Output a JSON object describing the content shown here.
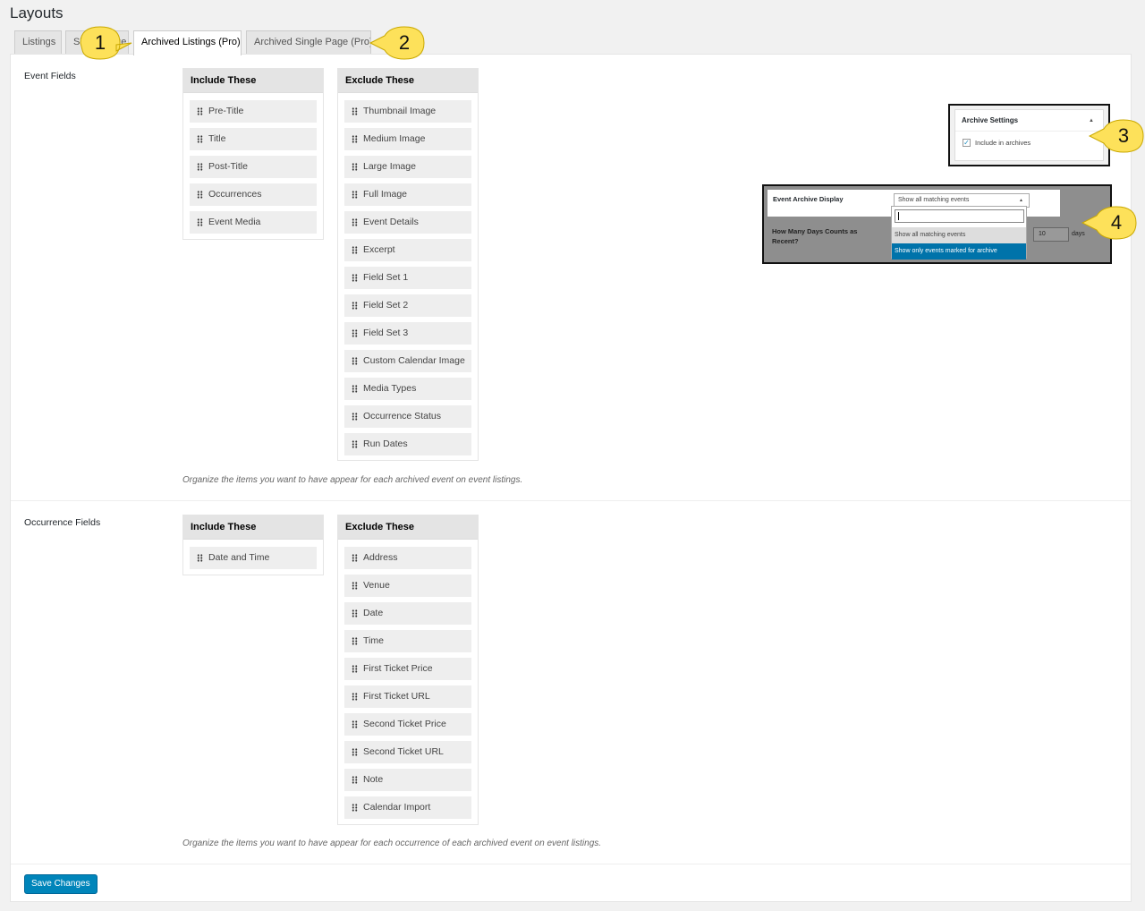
{
  "page": {
    "title": "Layouts"
  },
  "tabs": [
    {
      "label": "Listings"
    },
    {
      "label": "Single Page"
    },
    {
      "label": "Archived Listings (Pro)"
    },
    {
      "label": "Archived Single Page (Pro)"
    }
  ],
  "event_fields": {
    "label": "Event Fields",
    "include_header": "Include These",
    "include": [
      "Pre-Title",
      "Title",
      "Post-Title",
      "Occurrences",
      "Event Media"
    ],
    "exclude_header": "Exclude These",
    "exclude": [
      "Thumbnail Image",
      "Medium Image",
      "Large Image",
      "Full Image",
      "Event Details",
      "Excerpt",
      "Field Set 1",
      "Field Set 2",
      "Field Set 3",
      "Custom Calendar Image",
      "Media Types",
      "Occurrence Status",
      "Run Dates"
    ],
    "help": "Organize the items you want to have appear for each archived event on event listings."
  },
  "occurrence_fields": {
    "label": "Occurrence Fields",
    "include_header": "Include These",
    "include": [
      "Date and Time"
    ],
    "exclude_header": "Exclude These",
    "exclude": [
      "Address",
      "Venue",
      "Date",
      "Time",
      "First Ticket Price",
      "First Ticket URL",
      "Second Ticket Price",
      "Second Ticket URL",
      "Note",
      "Calendar Import"
    ],
    "help": "Organize the items you want to have appear for each occurrence of each archived event on event listings."
  },
  "save_button": "Save Changes",
  "archive_settings": {
    "title": "Archive Settings",
    "checkbox_label": "Include in archives",
    "checked": true
  },
  "archive_display": {
    "label": "Event Archive Display",
    "selected": "Show all matching events",
    "options": [
      "Show all matching events",
      "Show only events marked for archive"
    ],
    "recent_label": "How Many Days Counts as Recent?",
    "recent_value": "10",
    "recent_unit": "days"
  },
  "callouts": [
    "1",
    "2",
    "3",
    "4"
  ],
  "colors": {
    "callout": "#fde15a",
    "primary": "#0085ba",
    "selected_option": "#0073aa"
  }
}
